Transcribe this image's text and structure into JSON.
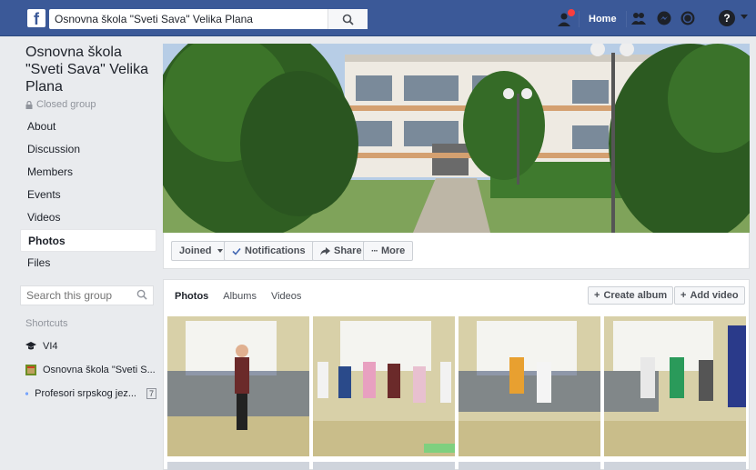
{
  "topbar": {
    "search_value": "Osnovna škola \"Sveti Sava\" Velika Plana",
    "home_label": "Home",
    "help_label": "?"
  },
  "sidebar": {
    "group_name": "Osnovna škola \"Sveti Sava\" Velika Plana",
    "privacy": "Closed group",
    "nav": [
      {
        "label": "About"
      },
      {
        "label": "Discussion"
      },
      {
        "label": "Members"
      },
      {
        "label": "Events"
      },
      {
        "label": "Videos"
      },
      {
        "label": "Photos"
      },
      {
        "label": "Files"
      }
    ],
    "search_placeholder": "Search this group",
    "shortcuts_title": "Shortcuts",
    "shortcuts": [
      {
        "label": "VI4"
      },
      {
        "label": "Osnovna škola \"Sveti S..."
      },
      {
        "label": "Profesori srpskog jez...",
        "badge": "7"
      }
    ]
  },
  "actions": {
    "joined": "Joined",
    "notifications": "Notifications",
    "share": "Share",
    "more": "More"
  },
  "photos": {
    "tabs": [
      {
        "label": "Photos"
      },
      {
        "label": "Albums"
      },
      {
        "label": "Videos"
      }
    ],
    "create_album": "Create album",
    "add_video": "Add video"
  },
  "colors": {
    "brand": "#3b5998",
    "background": "#e9ebee",
    "notification": "#fa3e3e"
  }
}
